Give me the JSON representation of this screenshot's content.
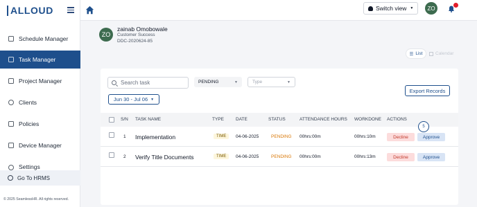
{
  "app": {
    "logo_text": "ALLOUD",
    "footer": "© 2025 SeamlessHR. All rights reserved."
  },
  "sidebar": {
    "items": [
      {
        "label": "Schedule Manager",
        "icon": "calendar-icon",
        "active": false
      },
      {
        "label": "Task Manager",
        "icon": "task-icon",
        "active": true
      },
      {
        "label": "Project Manager",
        "icon": "briefcase-icon",
        "active": false
      },
      {
        "label": "Clients",
        "icon": "person-icon",
        "active": false
      },
      {
        "label": "Policies",
        "icon": "document-icon",
        "active": false
      },
      {
        "label": "Device Manager",
        "icon": "device-icon",
        "active": false
      },
      {
        "label": "Settings",
        "icon": "gear-icon",
        "active": false
      }
    ],
    "goto_label": "Go To HRMS"
  },
  "topbar": {
    "switch_view_label": "Switch view",
    "user_initials": "ZO"
  },
  "profile": {
    "initials": "ZO",
    "name": "zainab Omobowale",
    "role": "Customer Success",
    "employee_id": "DDC-2020624-85"
  },
  "view_toggle": {
    "list_label": "List",
    "calendar_label": "Calendar"
  },
  "filters": {
    "search_placeholder": "Search task",
    "status_value": "PENDING",
    "type_placeholder": "Type",
    "date_range": "Jun 30 - Jul 06",
    "export_label": "Export Records"
  },
  "table": {
    "headers": {
      "sn": "S/N",
      "task_name": "TASK NAME",
      "type": "TYPE",
      "date": "DATE",
      "status": "STATUS",
      "attendance_hours": "ATTENDANCE HOURS",
      "workdone": "WORKDONE",
      "actions": "ACTIONS"
    },
    "rows": [
      {
        "sn": "1",
        "task_name": "Implementation",
        "type": "TIME",
        "date": "04-06-2025",
        "status": "PENDING",
        "attendance_hours": "00hrs:00m",
        "workdone": "00hrs:10m",
        "decline": "Decline",
        "approve": "Approve"
      },
      {
        "sn": "2",
        "task_name": "Verify Title Documents",
        "type": "TIME",
        "date": "04-06-2025",
        "status": "PENDING",
        "attendance_hours": "00hrs:00m",
        "workdone": "00hrs:13m",
        "decline": "Decline",
        "approve": "Approve"
      }
    ]
  },
  "step_marker": "5",
  "colors": {
    "primary": "#1e4f8c",
    "avatar": "#3d6b4f",
    "pending": "#d97706",
    "decline_bg": "#fcdcdc",
    "approve_bg": "#d8e4f5",
    "notification_dot": "#e11d2a"
  }
}
